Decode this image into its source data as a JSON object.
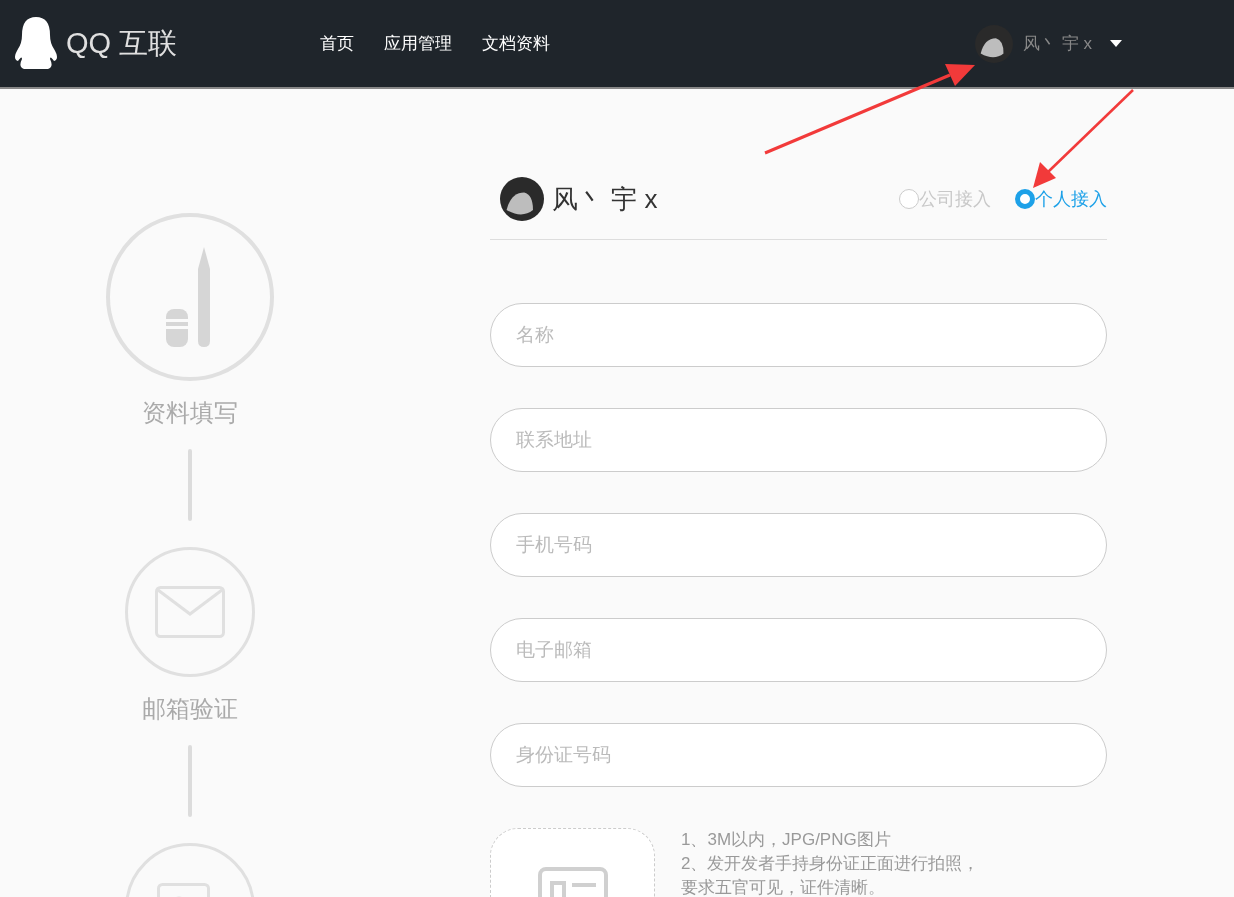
{
  "header": {
    "logo_text": "QQ 互联",
    "nav": [
      {
        "label": "首页",
        "selected": false
      },
      {
        "label": "应用管理",
        "selected": false
      },
      {
        "label": "文档资料",
        "selected": false
      }
    ],
    "user": {
      "name": "风丶 宇 x"
    }
  },
  "steps": [
    {
      "kind": "pencil",
      "label": "资料填写"
    },
    {
      "kind": "mail",
      "label": "邮箱验证"
    },
    {
      "kind": "id"
    }
  ],
  "form": {
    "user_name": "风丶 宇 x",
    "access_types": [
      {
        "label": "公司接入",
        "selected": false
      },
      {
        "label": "个人接入",
        "selected": true
      }
    ],
    "fields": [
      {
        "placeholder": "名称"
      },
      {
        "placeholder": "联系地址"
      },
      {
        "placeholder": "手机号码"
      },
      {
        "placeholder": "电子邮箱"
      },
      {
        "placeholder": "身份证号码"
      }
    ],
    "upload_notes": [
      "1、3M以内，JPG/PNG图片",
      "2、发开发者手持身份证正面进行拍照，",
      "要求五官可见，证件清晰。"
    ]
  }
}
